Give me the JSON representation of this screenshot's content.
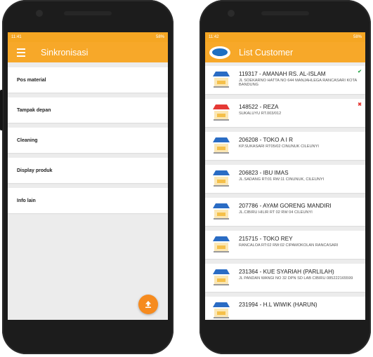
{
  "left_phone": {
    "statusbar": {
      "time": "11:41",
      "battery": "58%"
    },
    "title": "Sinkronisasi",
    "items": [
      {
        "label": "Pos material"
      },
      {
        "label": "Tampak depan"
      },
      {
        "label": "Cleaning"
      },
      {
        "label": "Display produk"
      },
      {
        "label": "Info lain"
      }
    ],
    "fab_icon": "upload-icon"
  },
  "right_phone": {
    "statusbar": {
      "time": "11:42",
      "battery": "58%"
    },
    "title": "List Customer",
    "customers": [
      {
        "title": "119317 - AMANAH RS. AL-ISLAM",
        "address": "JL SOEKARNO HATTA NO 644 MANJAHLEGA RANCASARI KOTA BANDUNG",
        "status": "✔",
        "status_type": "ok",
        "store_color": "blue"
      },
      {
        "title": "148522 - REZA",
        "address": "SUKALUYU RT.003/012",
        "status": "✖",
        "status_type": "bad",
        "store_color": "red"
      },
      {
        "title": "206208 - TOKO A I R",
        "address": "KP.SUKASARI RT05/02 CINUNUK CILEUNYI",
        "status": "",
        "status_type": "",
        "store_color": "blue"
      },
      {
        "title": "206823 - IBU IMAS",
        "address": "JL.SADANG RT:01 RW:11 CINUNUK, CILEUNYI",
        "status": "",
        "status_type": "",
        "store_color": "blue"
      },
      {
        "title": "207786 - AYAM GORENG MANDIRI",
        "address": "JL.CIBIRU HILIR RT 02 RW 04 CILEUNYI",
        "status": "",
        "status_type": "",
        "store_color": "blue"
      },
      {
        "title": "215715 - TOKO REY",
        "address": "RANCALOA RT:02 RW:02 CIPAMOKOLAN RANCASARI",
        "status": "",
        "status_type": "",
        "store_color": "blue"
      },
      {
        "title": "231364 - KUE SYARIAH (PARLILAH)",
        "address": "JL PANDAN WANGI NO 32 DPN SD LAB CIBIRU 085222165599",
        "status": "",
        "status_type": "",
        "store_color": "blue"
      },
      {
        "title": "231994 - H.L WIWIK (HARUN)",
        "address": "",
        "status": "",
        "status_type": "",
        "store_color": "blue"
      }
    ]
  },
  "colors": {
    "accent": "#f7a829",
    "fab": "#f68b1f",
    "ok": "#2aa84a",
    "bad": "#e53935",
    "store_blue": "#2a6cc4",
    "store_red": "#e53935"
  }
}
